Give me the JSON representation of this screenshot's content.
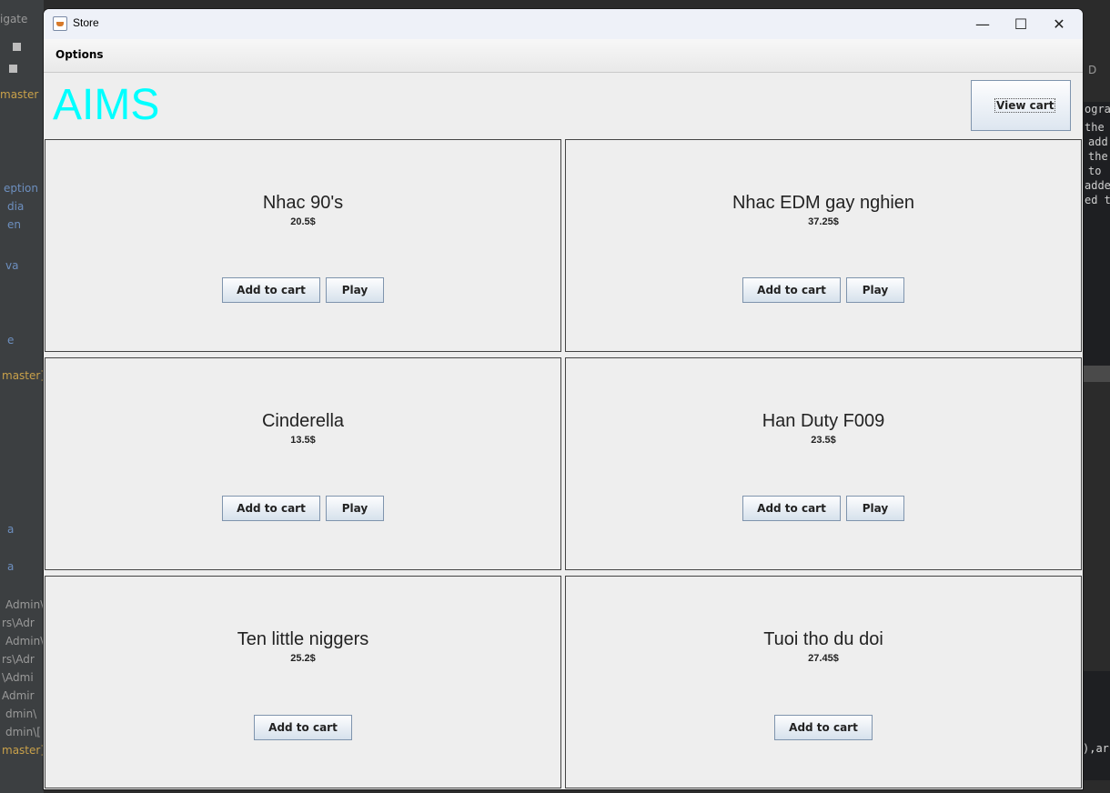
{
  "background": {
    "left_snippets": [
      "igate",
      "master",
      "eption",
      "dia",
      "en",
      "va",
      "e",
      "master]",
      "a",
      "a",
      "Admin\\",
      "rs\\Adr",
      "Admin\\",
      "rs\\Adr",
      "\\Admi",
      "Admir",
      "dmin\\",
      "dmin\\[",
      "master]"
    ],
    "right_snippets": [
      "D",
      "ogra",
      "the",
      "add",
      "the",
      "to",
      "adde",
      "ed t",
      "),ar"
    ]
  },
  "window": {
    "title": "Store",
    "controls": {
      "minimize": "—",
      "maximize": "☐",
      "close": "✕"
    }
  },
  "menubar": {
    "options_label": "Options"
  },
  "header": {
    "app_title": "AIMS",
    "view_cart_label": "View cart",
    "title_color": "#00ffff"
  },
  "products": [
    {
      "title": "Nhac 90's",
      "price": "20.5$",
      "add_label": "Add to cart",
      "play_label": "Play",
      "has_play": true
    },
    {
      "title": "Nhac EDM gay nghien",
      "price": "37.25$",
      "add_label": "Add to cart",
      "play_label": "Play",
      "has_play": true
    },
    {
      "title": "Cinderella",
      "price": "13.5$",
      "add_label": "Add to cart",
      "play_label": "Play",
      "has_play": true
    },
    {
      "title": "Han Duty F009",
      "price": "23.5$",
      "add_label": "Add to cart",
      "play_label": "Play",
      "has_play": true
    },
    {
      "title": "Ten little niggers",
      "price": "25.2$",
      "add_label": "Add to cart",
      "has_play": false
    },
    {
      "title": "Tuoi tho du doi",
      "price": "27.45$",
      "add_label": "Add to cart",
      "has_play": false
    }
  ]
}
